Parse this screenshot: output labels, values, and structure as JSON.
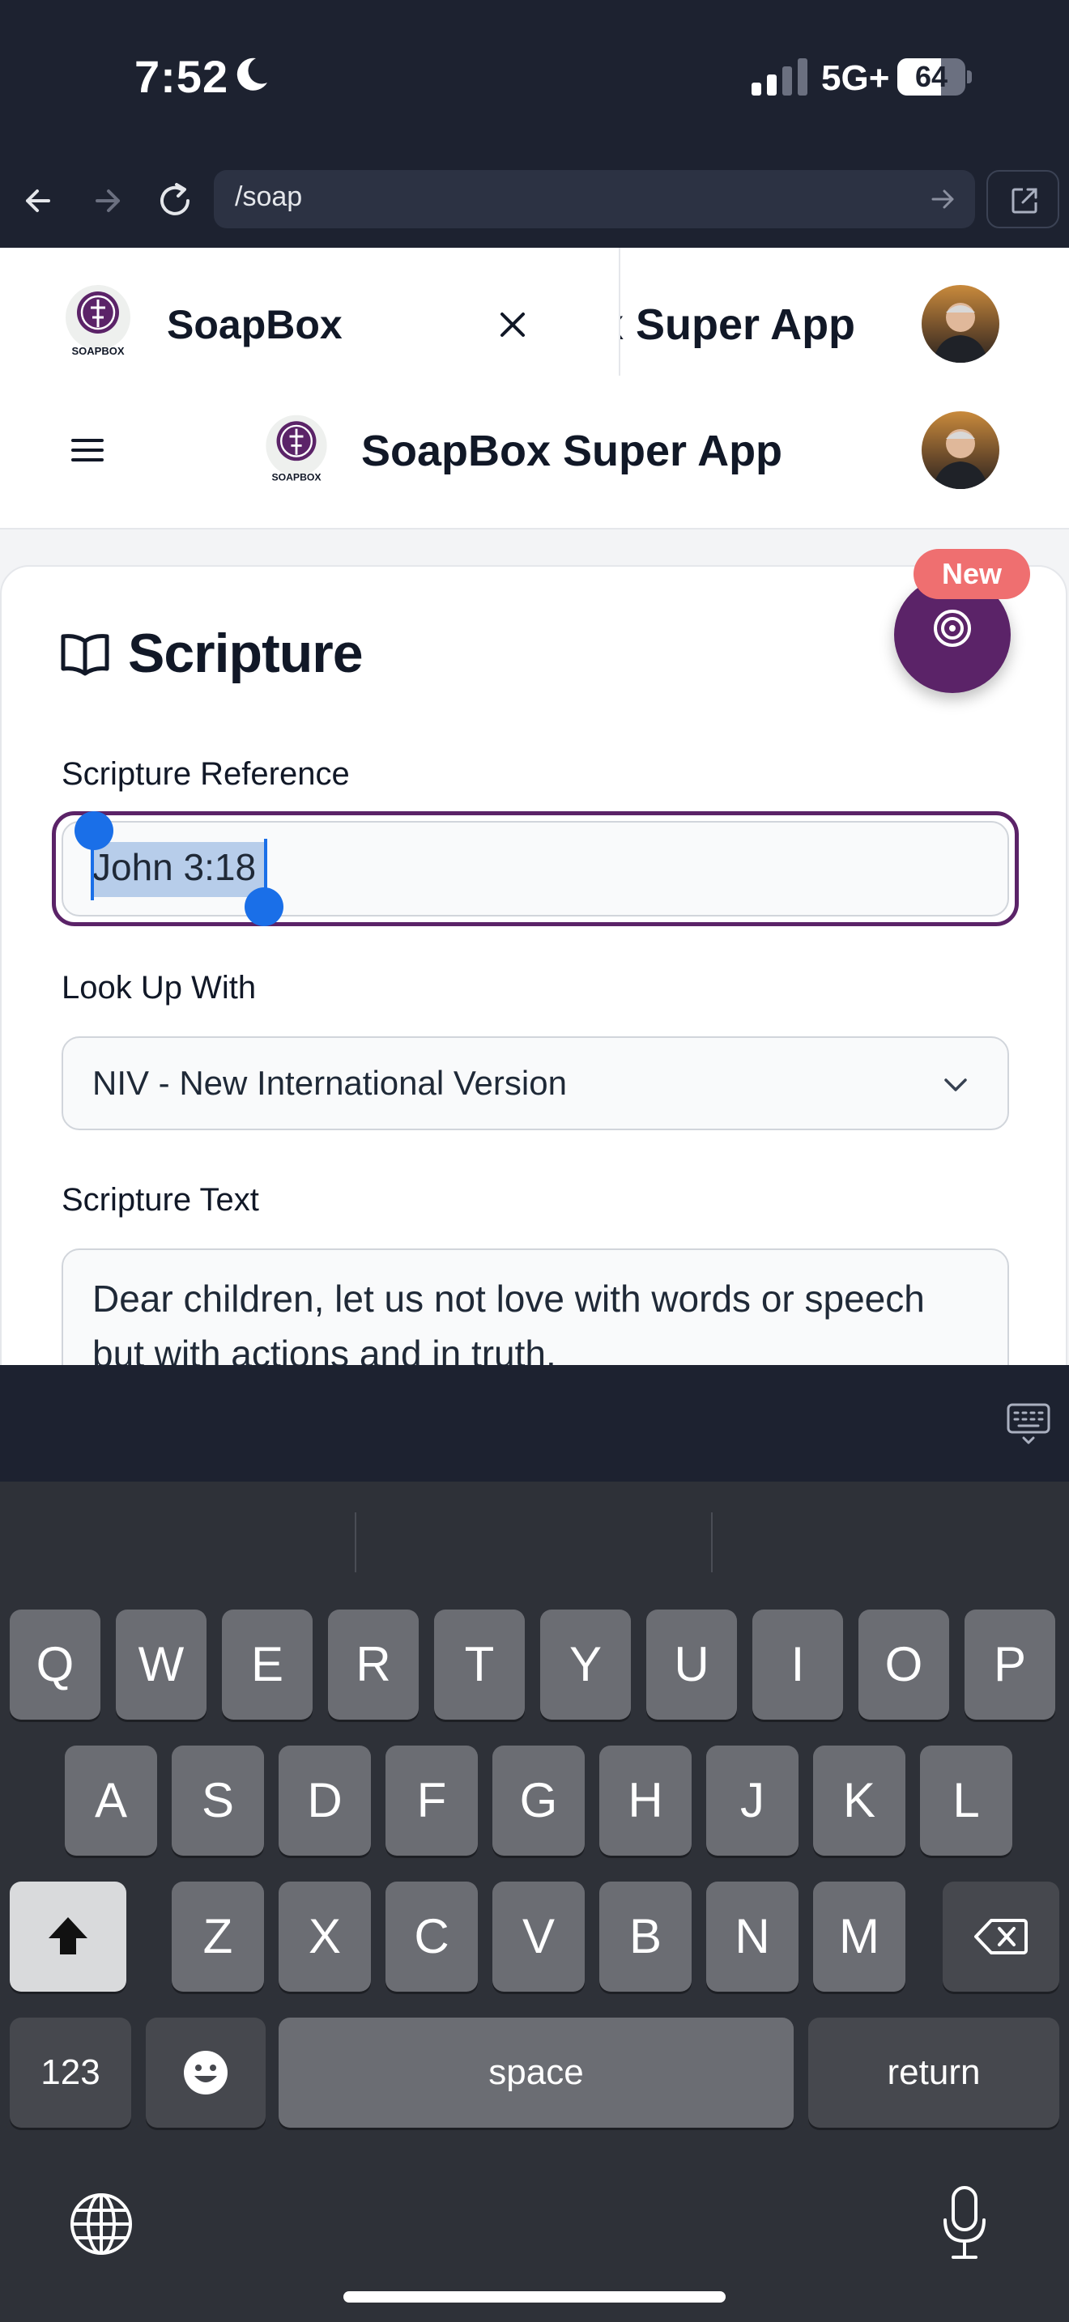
{
  "status_bar": {
    "time": "7:52",
    "network": "5G+",
    "battery": "64",
    "battery_level": 0.64
  },
  "browser": {
    "url": "/soap"
  },
  "drawer": {
    "title": "SoapBox",
    "peek_title": "SoapBox Super App"
  },
  "logo": {
    "text": "SOAPBOX"
  },
  "header": {
    "title": "SoapBox Super App"
  },
  "card": {
    "title": "Scripture",
    "reference_label": "Scripture Reference",
    "reference_value": "John 3:18",
    "lookup_label": "Look Up With",
    "lookup_value": "NIV - New International Version",
    "text_label": "Scripture Text",
    "text_value": "Dear children, let us not love with words or speech but with actions and in truth."
  },
  "fab": {
    "badge": "New"
  },
  "keyboard": {
    "row1": [
      "Q",
      "W",
      "E",
      "R",
      "T",
      "Y",
      "U",
      "I",
      "O",
      "P"
    ],
    "row2": [
      "A",
      "S",
      "D",
      "F",
      "G",
      "H",
      "J",
      "K",
      "L"
    ],
    "row3": [
      "Z",
      "X",
      "C",
      "V",
      "B",
      "N",
      "M"
    ],
    "numbers": "123",
    "space": "space",
    "return": "return"
  },
  "colors": {
    "brand": "#5b2368",
    "badge": "#ef6f70",
    "selection": "#b7cdea",
    "handle": "#1a6fe8"
  }
}
